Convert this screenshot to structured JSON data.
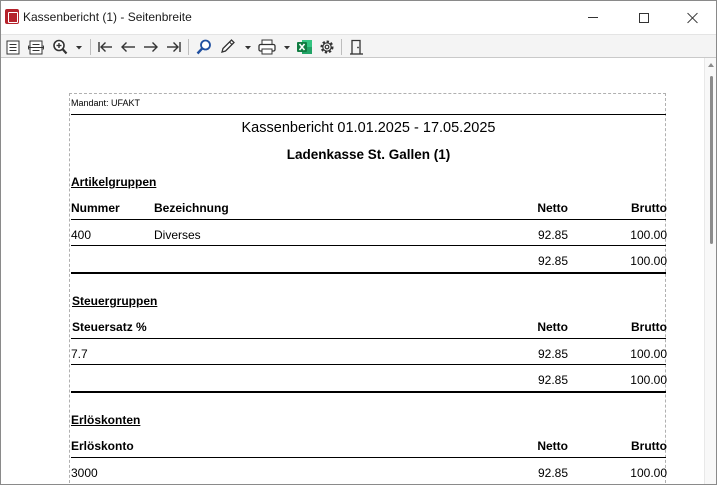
{
  "window": {
    "title": "Kassenbericht (1) - Seitenbreite"
  },
  "toolbar": {
    "icons": [
      "page-view-icon",
      "page-width-icon",
      "zoom-icon",
      "first-page-icon",
      "previous-page-icon",
      "next-page-icon",
      "last-page-icon",
      "search-icon",
      "edit-pen-icon",
      "print-icon",
      "excel-icon",
      "settings-icon",
      "exit-door-icon"
    ]
  },
  "report": {
    "mandant": "Mandant: UFAKT",
    "title": "Kassenbericht 01.01.2025 - 17.05.2025",
    "subtitle": "Ladenkasse St. Gallen (1)",
    "artikelgruppen": {
      "heading": "Artikelgruppen",
      "col_nummer": "Nummer",
      "col_bezeichnung": "Bezeichnung",
      "col_netto": "Netto",
      "col_brutto": "Brutto",
      "row": {
        "nummer": "400",
        "bezeichnung": "Diverses",
        "netto": "92.85",
        "brutto": "100.00"
      },
      "total": {
        "netto": "92.85",
        "brutto": "100.00"
      }
    },
    "steuergruppen": {
      "heading": "Steuergruppen",
      "col_steuersatz": "Steuersatz %",
      "col_netto": "Netto",
      "col_brutto": "Brutto",
      "row": {
        "steuersatz": "7.7",
        "netto": "92.85",
        "brutto": "100.00"
      },
      "total": {
        "netto": "92.85",
        "brutto": "100.00"
      }
    },
    "erloeskonten": {
      "heading": "Erlöskonten",
      "col_konto": "Erlöskonto",
      "col_netto": "Netto",
      "col_brutto": "Brutto",
      "row": {
        "konto": "3000",
        "netto": "92.85",
        "brutto": "100.00"
      }
    }
  }
}
